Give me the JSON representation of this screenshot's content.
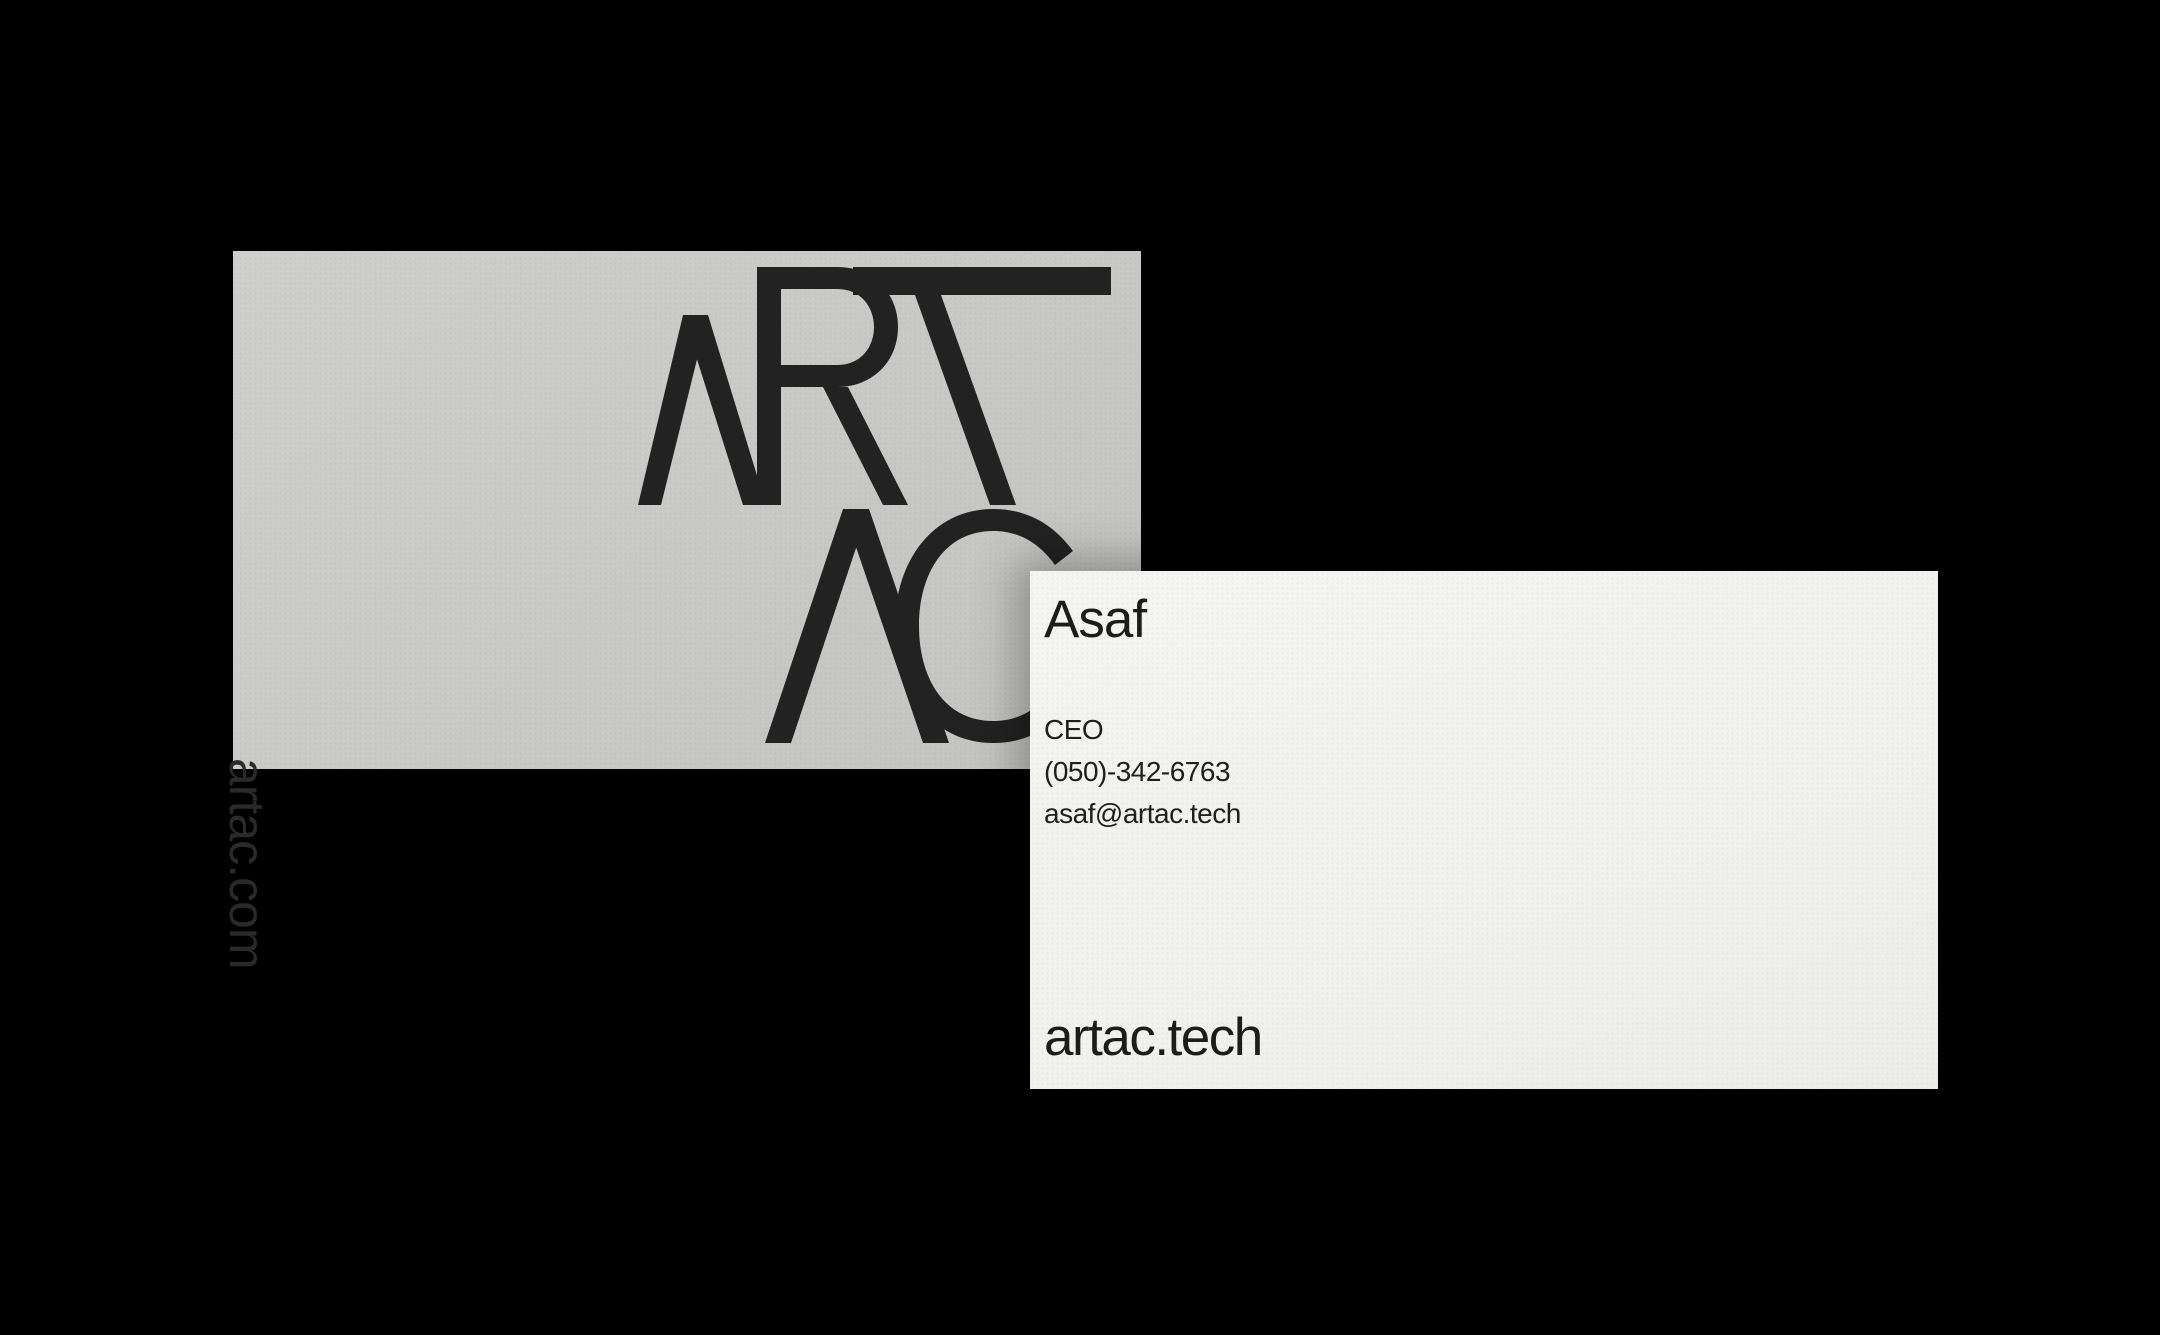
{
  "back_card": {
    "logo_text": "ARTAC",
    "website": "artac.com"
  },
  "front_card": {
    "name": "Asaf",
    "role": "CEO",
    "phone": "(050)-342-6763",
    "email": "asaf@artac.tech",
    "website": "artac.tech"
  },
  "colors": {
    "background": "#000000",
    "back_card": "#cbcbc9",
    "front_card": "#f2f2f0",
    "ink": "#1c1c1c"
  }
}
